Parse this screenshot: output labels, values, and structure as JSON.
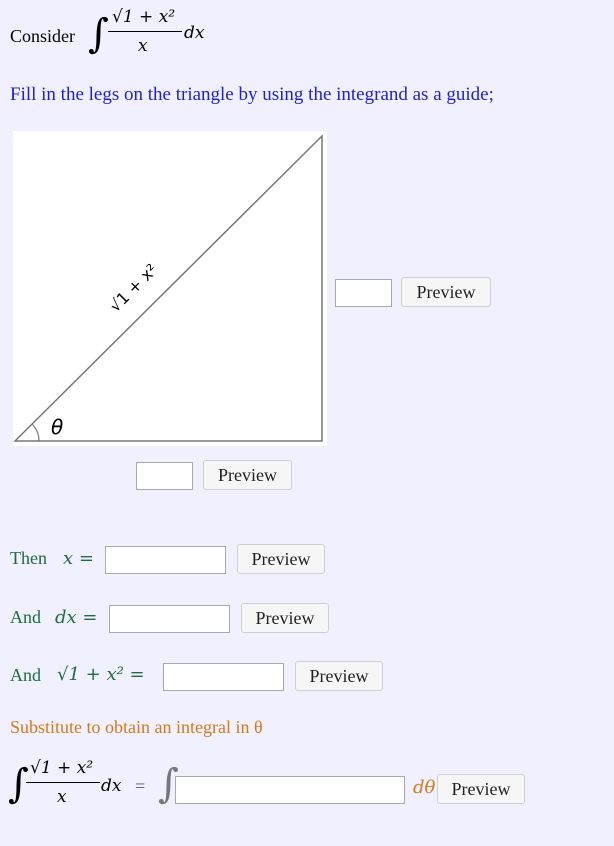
{
  "consider": {
    "label": "Consider",
    "integrand_num": "√1 + x²",
    "integrand_den": "x",
    "dx": "dx"
  },
  "instruction": "Fill in the legs on the triangle by using the integrand as a guide;",
  "triangle": {
    "hypotenuse_label": "√1 + x²",
    "angle_label": "θ"
  },
  "preview_label": "Preview",
  "then_x": {
    "label": "Then",
    "lhs": "x ="
  },
  "and_dx": {
    "label": "And",
    "lhs": "dx ="
  },
  "and_sqrt": {
    "label": "And",
    "lhs": "√1 + x² ="
  },
  "substitute": "Substitute to obtain an integral in θ",
  "final": {
    "lhs_num": "√1 + x²",
    "lhs_den": "x",
    "dx": "dx",
    "equals": "=",
    "dtheta": "dθ"
  },
  "colors": {
    "background": "#f0f0ff",
    "instruction": "#1f1fcf",
    "then": "#1e6b3e",
    "substitute": "#d57a17"
  }
}
